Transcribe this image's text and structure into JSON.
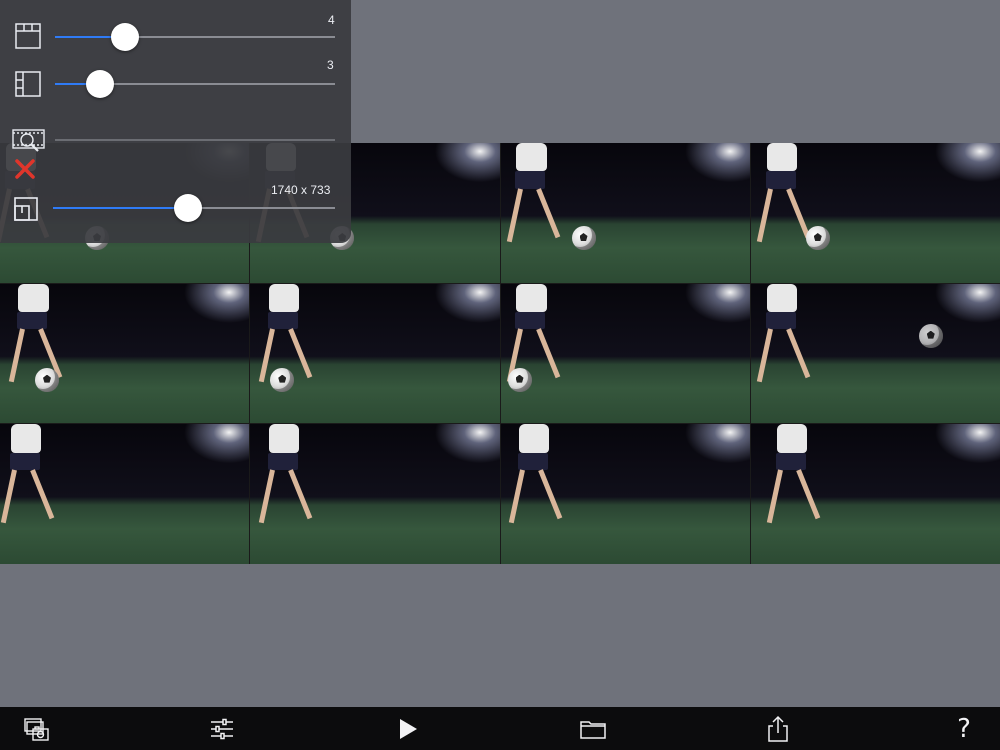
{
  "panel": {
    "rows": [
      {
        "id": "columns",
        "icon": "columns-icon",
        "value_label": "4",
        "fraction": 0.25
      },
      {
        "id": "rows",
        "icon": "rows-icon",
        "value_label": "3",
        "fraction": 0.16
      },
      {
        "id": "zoom",
        "icon": "film-zoom-icon",
        "secondary_icon": "delete-x-icon",
        "value_label": "",
        "fraction": 0
      },
      {
        "id": "resolution",
        "icon": "resize-icon",
        "value_label": "1740 x 733",
        "fraction": 0.48
      }
    ]
  },
  "sheet": {
    "columns": 4,
    "rows": 3
  },
  "toolbar": {
    "buttons": [
      {
        "name": "capture-frames-button",
        "icon": "capture-frames-icon"
      },
      {
        "name": "settings-button",
        "icon": "sliders-icon"
      },
      {
        "name": "play-button",
        "icon": "play-icon"
      },
      {
        "name": "open-folder-button",
        "icon": "folder-icon"
      },
      {
        "name": "share-button",
        "icon": "share-icon"
      },
      {
        "name": "help-button",
        "icon": "help-icon",
        "label": "?"
      }
    ]
  },
  "colors": {
    "accent": "#2f7bf6",
    "delete": "#e0352b",
    "background": "#6f727b",
    "toolbar": "#0c0c0d"
  }
}
